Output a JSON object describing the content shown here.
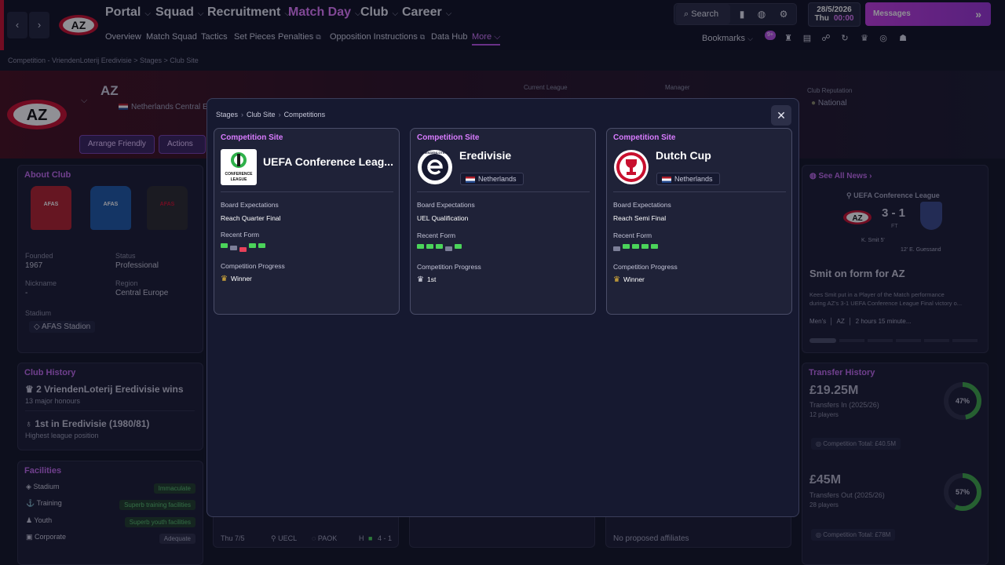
{
  "topbar": {
    "menus": [
      {
        "label": "Portal",
        "active": false
      },
      {
        "label": "Squad",
        "active": false
      },
      {
        "label": "Recruitment",
        "active": false
      },
      {
        "label": "Match Day",
        "active": true
      },
      {
        "label": "Club",
        "active": false
      },
      {
        "label": "Career",
        "active": false
      }
    ],
    "submenu": [
      "Overview",
      "Match Squad",
      "Tactics",
      "Set Pieces",
      "Penalties",
      "Opposition Instructions",
      "Data Hub",
      "More"
    ],
    "search_label": "Search",
    "date": "28/5/2026",
    "day": "Thu",
    "time": "00:00",
    "messages_label": "Messages",
    "bookmarks_label": "Bookmarks",
    "badge": "9+",
    "club_abbr": "AZ"
  },
  "background": {
    "breadcrumb": "Competition - VriendenLoterij Eredivisie  >  Stages  >  Club Site",
    "club_name": "AZ",
    "country": "Netherlands",
    "region_partial": "Central E",
    "current_league_label": "Current League",
    "manager_label": "Manager",
    "reputation_label": "Club Reputation",
    "reputation_value": "National",
    "arrange_friendly": "Arrange Friendly",
    "actions": "Actions",
    "about_club": {
      "title": "About Club",
      "kit_text": "AFAS",
      "founded_label": "Founded",
      "founded": "1967",
      "status_label": "Status",
      "status": "Professional",
      "nickname_label": "Nickname",
      "nickname": "-",
      "region_label": "Region",
      "region": "Central Europe",
      "stadium_label": "Stadium",
      "stadium": "AFAS Stadion"
    },
    "club_history": {
      "title": "Club History",
      "wins": "2 VriendenLoterij Eredivisie wins",
      "honours": "13  major honours",
      "best": "1st in Eredivisie (1980/81)",
      "best_sub": "Highest league position"
    },
    "facilities": {
      "title": "Facilities",
      "rows": [
        {
          "name": "Stadium",
          "value": "Immaculate"
        },
        {
          "name": "Training",
          "value": "Superb training facilities"
        },
        {
          "name": "Youth",
          "value": "Superb youth facilities"
        },
        {
          "name": "Corporate",
          "value": "Adequate"
        }
      ]
    },
    "fixture": {
      "date": "Thu 7/5",
      "comp": "UECL",
      "opp": "PAOK",
      "venue": "H",
      "score": "4 - 1"
    },
    "affiliates": "No proposed affiliates",
    "news": {
      "see_all": "See All News",
      "competition": "UEFA Conference League",
      "score": "3 - 1",
      "status": "FT",
      "scorer_home": "K. Smit  5'",
      "scorer_away": "12'  E. Guessand",
      "headline": "Smit on form for AZ",
      "body1": "Kees Smit put in a Player of the Match performance",
      "body2": "during AZ's 3-1 UEFA Conference League Final victory o...",
      "tag1": "Men's",
      "tag2": "AZ",
      "time": "2 hours 15 minute..."
    },
    "transfers": {
      "title": "Transfer History",
      "in_amount": "£19.25M",
      "in_label": "Transfers In (2025/26)",
      "in_players": "12 players",
      "in_pct": 47,
      "in_pct_label": "47%",
      "comp_total_in": "Competition Total:  £40.5M",
      "out_amount": "£45M",
      "out_label": "Transfers Out (2025/26)",
      "out_players": "28 players",
      "out_pct": 57,
      "out_pct_label": "57%",
      "comp_total_out": "Competition Total:  £78M"
    }
  },
  "modal": {
    "breadcrumb": [
      "Stages",
      "Club Site",
      "Competitions"
    ],
    "cards": [
      {
        "header": "Competition Site",
        "name": "UEFA Conference Leag...",
        "logo_text": "CONFERENCE LEAGUE",
        "country": "",
        "board_label": "Board Expectations",
        "board_value": "Reach Quarter Final",
        "form_label": "Recent Form",
        "form": [
          "W",
          "D",
          "L",
          "W",
          "W"
        ],
        "progress_label": "Competition Progress",
        "progress_value": "Winner",
        "trophy_color": "#e3b53a"
      },
      {
        "header": "Competition Site",
        "name": "Eredivisie",
        "logo_text": "VRIENDENLOTERIJ",
        "country": "Netherlands",
        "board_label": "Board Expectations",
        "board_value": "UEL Qualification",
        "form_label": "Recent Form",
        "form": [
          "W",
          "W",
          "W",
          "D",
          "W"
        ],
        "progress_label": "Competition Progress",
        "progress_value": "1st",
        "trophy_color": "#e6e7f2"
      },
      {
        "header": "Competition Site",
        "name": "Dutch Cup",
        "logo_text": "",
        "country": "Netherlands",
        "board_label": "Board Expectations",
        "board_value": "Reach Semi Final",
        "form_label": "Recent Form",
        "form": [
          "D",
          "W",
          "W",
          "W",
          "W"
        ],
        "progress_label": "Competition Progress",
        "progress_value": "Winner",
        "trophy_color": "#e3b53a"
      }
    ]
  },
  "colors": {
    "accent": "#d97cff",
    "win": "#4bd45a",
    "draw": "#7c7f98",
    "loss": "#e8415a",
    "brand_red": "#c8102e"
  }
}
